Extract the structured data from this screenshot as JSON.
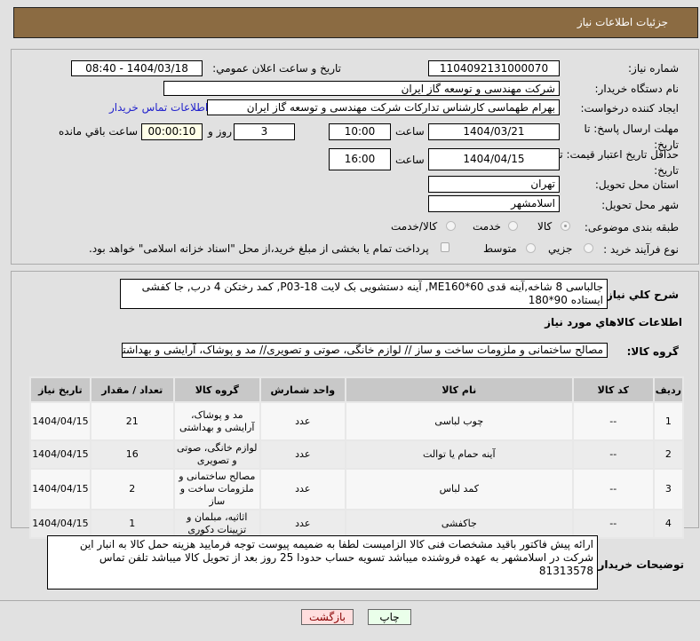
{
  "header": {
    "title": "جزئیات اطلاعات نیاز"
  },
  "form": {
    "need_number_label": "شماره نیاز:",
    "need_number": "1104092131000070",
    "announce_label": "تاریخ و ساعت اعلان عمومي:",
    "announce_value": "1404/03/18 - 08:40",
    "buyer_org_label": "نام دستگاه خریدار:",
    "buyer_org": "شرکت مهندسی و توسعه گاز ایران",
    "creator_label": "ایجاد کننده درخواست:",
    "creator": "بهرام طهماسی کارشناس تدارکات شرکت مهندسی و توسعه گاز ایران",
    "contact_link": "اطلاعات تماس خریدار",
    "deadline_label": "مهلت ارسال پاسخ: تا تاریخ:",
    "deadline_date": "1404/03/21",
    "time_label": "ساعت",
    "deadline_time": "10:00",
    "days": "3",
    "days_label": "روز و",
    "remaining": "00:00:10",
    "remaining_label": "ساعت باقي مانده",
    "validity_label": "حداقل تاریخ اعتبار قیمت: تا تاریخ:",
    "validity_date": "1404/04/15",
    "validity_time": "16:00",
    "province_label": "استان محل تحویل:",
    "province": "تهران",
    "city_label": "شهر محل تحویل:",
    "city": "اسلامشهر",
    "category_label": "طبقه بندی موضوعی:",
    "category_options": [
      "کالا",
      "خدمت",
      "کالا/خدمت"
    ],
    "category_selected": "کالا",
    "process_label": "نوع فرآیند خرید :",
    "process_options": [
      "جزیي",
      "متوسط"
    ],
    "payment_note": "پرداخت تمام یا بخشی از مبلغ خرید،از محل \"اسناد خزانه اسلامی\" خواهد بود."
  },
  "description": {
    "label": "شرح کلي نیاز:",
    "value": "جالباسی 8 شاخه,آینه قدی ME160*60, آینه دستشویی بک لایت P03-18, کمد رختکن 4 درب, جا کفشی ایستاده 90*180"
  },
  "goods": {
    "heading": "اطلاعات کالاهاي مورد نیاز",
    "group_label": "گروه کالا:",
    "group_value": "مصالح ساختمانی و ملزومات ساخت و ساز // لوازم خانگی، صوتی و تصویری// مد و پوشاک، آرایشی و بهداشتی",
    "columns": [
      "ردیف",
      "کد کالا",
      "نام کالا",
      "واحد شمارش",
      "گروه کالا",
      "تعداد / مقدار",
      "تاریخ نیاز"
    ],
    "rows": [
      [
        "1",
        "--",
        "چوب لباسی",
        "عدد",
        "مد و پوشاک، آرایشی و بهداشتی",
        "21",
        "1404/04/15"
      ],
      [
        "2",
        "--",
        "آینه حمام یا توالت",
        "عدد",
        "لوازم خانگی، صوتی و تصویری",
        "16",
        "1404/04/15"
      ],
      [
        "3",
        "--",
        "کمد لباس",
        "عدد",
        "مصالح ساختمانی و ملزومات ساخت و ساز",
        "2",
        "1404/04/15"
      ],
      [
        "4",
        "--",
        "جاکفشی",
        "عدد",
        "اثاثیه، مبلمان و تزیینات دکوری",
        "1",
        "1404/04/15"
      ]
    ]
  },
  "notes": {
    "label": "توضیحات خریدار:",
    "value": "ارائه پیش فاکتور باقید مشخصات فنی کالا الزامیست لطفا به ضمیمه پیوست توجه فرمایید هزینه حمل کالا به انبار این شرکت در اسلامشهر به عهده فروشنده میباشد تسویه حساب حدودا 25 روز بعد از تحویل کالا میباشد تلفن تماس 81313578"
  },
  "buttons": {
    "print": "چاپ",
    "back": "بازگشت"
  },
  "colors": {
    "header": "#8b6b42",
    "back_button": "#ffdede",
    "print_button": "#eaffea",
    "link": "#2222cc"
  }
}
